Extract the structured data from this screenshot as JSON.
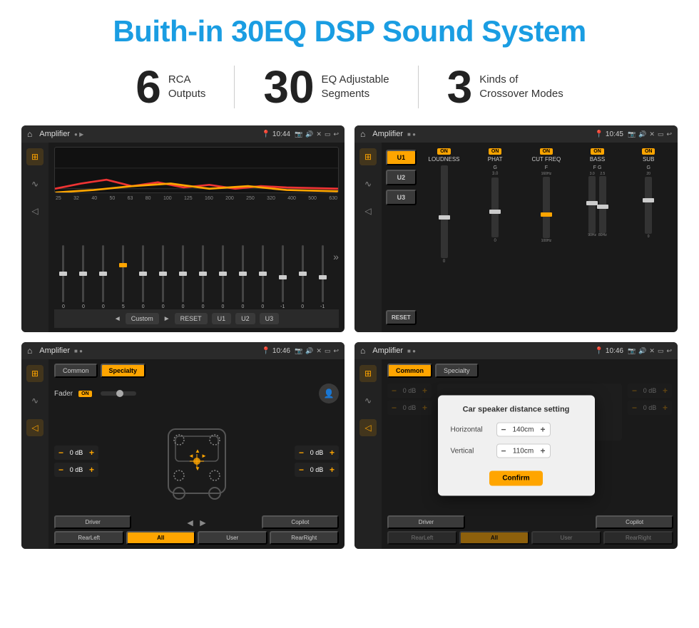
{
  "title": "Buith-in 30EQ DSP Sound System",
  "stats": [
    {
      "number": "6",
      "label": "RCA\nOutputs"
    },
    {
      "number": "30",
      "label": "EQ Adjustable\nSegments"
    },
    {
      "number": "3",
      "label": "Kinds of\nCrossover Modes"
    }
  ],
  "screens": [
    {
      "id": "eq-screen",
      "topbar": {
        "title": "Amplifier",
        "time": "10:44"
      },
      "type": "eq",
      "freq_labels": [
        "25",
        "32",
        "40",
        "50",
        "63",
        "80",
        "100",
        "125",
        "160",
        "200",
        "250",
        "320",
        "400",
        "500",
        "630"
      ],
      "slider_values": [
        "0",
        "0",
        "0",
        "5",
        "0",
        "0",
        "0",
        "0",
        "0",
        "0",
        "0",
        "-1",
        "0",
        "-1"
      ],
      "bottom_buttons": [
        "Custom",
        "RESET",
        "U1",
        "U2",
        "U3"
      ]
    },
    {
      "id": "crossover-screen",
      "topbar": {
        "title": "Amplifier",
        "time": "10:45"
      },
      "type": "crossover",
      "u_buttons": [
        "U1",
        "U2",
        "U3"
      ],
      "channels": [
        {
          "on": true,
          "label": "LOUDNESS"
        },
        {
          "on": true,
          "label": "PHAT"
        },
        {
          "on": true,
          "label": "CUT FREQ"
        },
        {
          "on": true,
          "label": "BASS"
        },
        {
          "on": true,
          "label": "SUB"
        }
      ],
      "reset_label": "RESET"
    },
    {
      "id": "fader-screen",
      "topbar": {
        "title": "Amplifier",
        "time": "10:46"
      },
      "type": "fader",
      "tabs": [
        "Common",
        "Specialty"
      ],
      "active_tab": "Specialty",
      "fader_label": "Fader",
      "fader_on": "ON",
      "db_values": [
        "0 dB",
        "0 dB",
        "0 dB",
        "0 dB"
      ],
      "bottom_buttons": [
        "Driver",
        "",
        "",
        "Copilot",
        "RearLeft",
        "All",
        "User",
        "RearRight"
      ]
    },
    {
      "id": "distance-screen",
      "topbar": {
        "title": "Amplifier",
        "time": "10:46"
      },
      "type": "distance",
      "tabs": [
        "Common",
        "Specialty"
      ],
      "active_tab": "Common",
      "dialog": {
        "title": "Car speaker distance setting",
        "horizontal_label": "Horizontal",
        "horizontal_value": "140cm",
        "vertical_label": "Vertical",
        "vertical_value": "110cm",
        "confirm_label": "Confirm"
      },
      "db_values": [
        "0 dB",
        "0 dB"
      ],
      "bottom_buttons": [
        "Driver",
        "",
        "",
        "Copilot",
        "RearLeft",
        "All",
        "User",
        "RearRight"
      ]
    }
  ]
}
